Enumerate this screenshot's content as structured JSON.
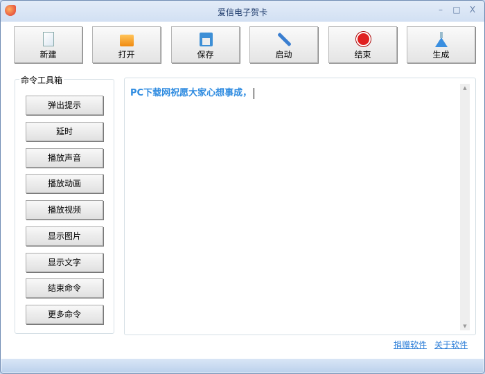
{
  "window": {
    "title": "爱信电子贺卡",
    "minimize": "–",
    "maximize": "□",
    "close": "X"
  },
  "toolbar": [
    {
      "label": "新建",
      "icon": "new-file-icon"
    },
    {
      "label": "打开",
      "icon": "folder-icon"
    },
    {
      "label": "保存",
      "icon": "save-icon"
    },
    {
      "label": "启动",
      "icon": "wrench-icon"
    },
    {
      "label": "结束",
      "icon": "stop-hand-icon"
    },
    {
      "label": "生成",
      "icon": "flask-icon"
    }
  ],
  "toolbox": {
    "title": "命令工具箱",
    "commands": [
      "弹出提示",
      "延时",
      "播放声音",
      "播放动画",
      "播放视频",
      "显示图片",
      "显示文字",
      "结束命令",
      "更多命令"
    ]
  },
  "editor": {
    "content": "PC下载网祝愿大家心想事成，"
  },
  "links": {
    "donate": "捐赠软件",
    "about": "关于软件"
  },
  "colors": {
    "text": "#2e8be0",
    "link": "#2f7fd8"
  }
}
